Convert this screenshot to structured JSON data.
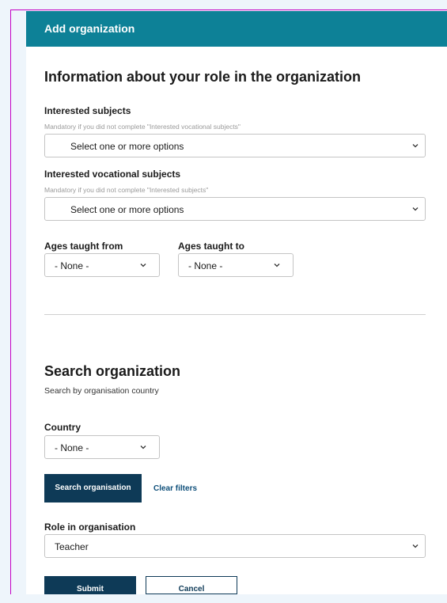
{
  "header": {
    "title": "Add organization"
  },
  "role_section": {
    "heading": "Information about your role in the organization",
    "interested_subjects": {
      "label": "Interested subjects",
      "hint": "Mandatory if you did not complete \"Interested vocational subjects\"",
      "value": "Select one or more options"
    },
    "interested_vocational_subjects": {
      "label": "Interested vocational subjects",
      "hint": "Mandatory if you did not complete \"Interested subjects\"",
      "value": "Select one or more options"
    },
    "ages_from": {
      "label": "Ages taught from",
      "value": "- None -"
    },
    "ages_to": {
      "label": "Ages taught to",
      "value": "- None -"
    }
  },
  "search_section": {
    "heading": "Search organization",
    "description": "Search by organisation country",
    "country": {
      "label": "Country",
      "value": "- None -"
    },
    "search_button": "Search organisation",
    "clear_filters": "Clear filters",
    "role": {
      "label": "Role in organisation",
      "value": "Teacher"
    }
  },
  "actions": {
    "submit": "Submit",
    "cancel": "Cancel"
  },
  "icons": {
    "dropdown": "chevron-down-icon"
  },
  "colors": {
    "header_bg": "#0d8197",
    "primary_button": "#0e3a57",
    "page_bg": "#eef5fb"
  }
}
